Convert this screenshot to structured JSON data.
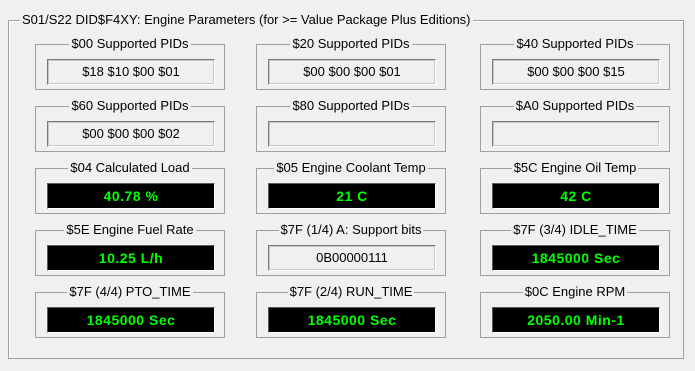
{
  "panel": {
    "title": "S01/S22 DID$F4XY: Engine Parameters (for >= Value Package Plus Editions)"
  },
  "rows": [
    [
      {
        "label": "$00 Supported PIDs",
        "value": "$18 $10 $00 $01",
        "live": false
      },
      {
        "label": "$20 Supported PIDs",
        "value": "$00 $00 $00 $01",
        "live": false
      },
      {
        "label": "$40 Supported PIDs",
        "value": "$00 $00 $00 $15",
        "live": false
      }
    ],
    [
      {
        "label": "$60 Supported PIDs",
        "value": "$00 $00 $00 $02",
        "live": false
      },
      {
        "label": "$80 Supported PIDs",
        "value": "",
        "live": false
      },
      {
        "label": "$A0 Supported PIDs",
        "value": "",
        "live": false
      }
    ],
    [
      {
        "label": "$04 Calculated Load",
        "value": "40.78 %",
        "live": true
      },
      {
        "label": "$05 Engine Coolant Temp",
        "value": "21 C",
        "live": true
      },
      {
        "label": "$5C Engine Oil Temp",
        "value": "42 C",
        "live": true
      }
    ],
    [
      {
        "label": "$5E Engine Fuel Rate",
        "value": "10.25 L/h",
        "live": true
      },
      {
        "label": "$7F (1/4) A: Support bits",
        "value": "0B00000111",
        "live": false
      },
      {
        "label": "$7F (3/4) IDLE_TIME",
        "value": "1845000 Sec",
        "live": true
      }
    ],
    [
      {
        "label": "$7F (4/4) PTO_TIME",
        "value": "1845000 Sec",
        "live": true
      },
      {
        "label": "$7F (2/4) RUN_TIME",
        "value": "1845000 Sec",
        "live": true
      },
      {
        "label": "$0C Engine RPM",
        "value": "2050.00 Min-1",
        "live": true
      }
    ]
  ],
  "colors": {
    "live_background": "#000000",
    "live_text": "#00ff00",
    "window_background": "#f0f0f0"
  }
}
